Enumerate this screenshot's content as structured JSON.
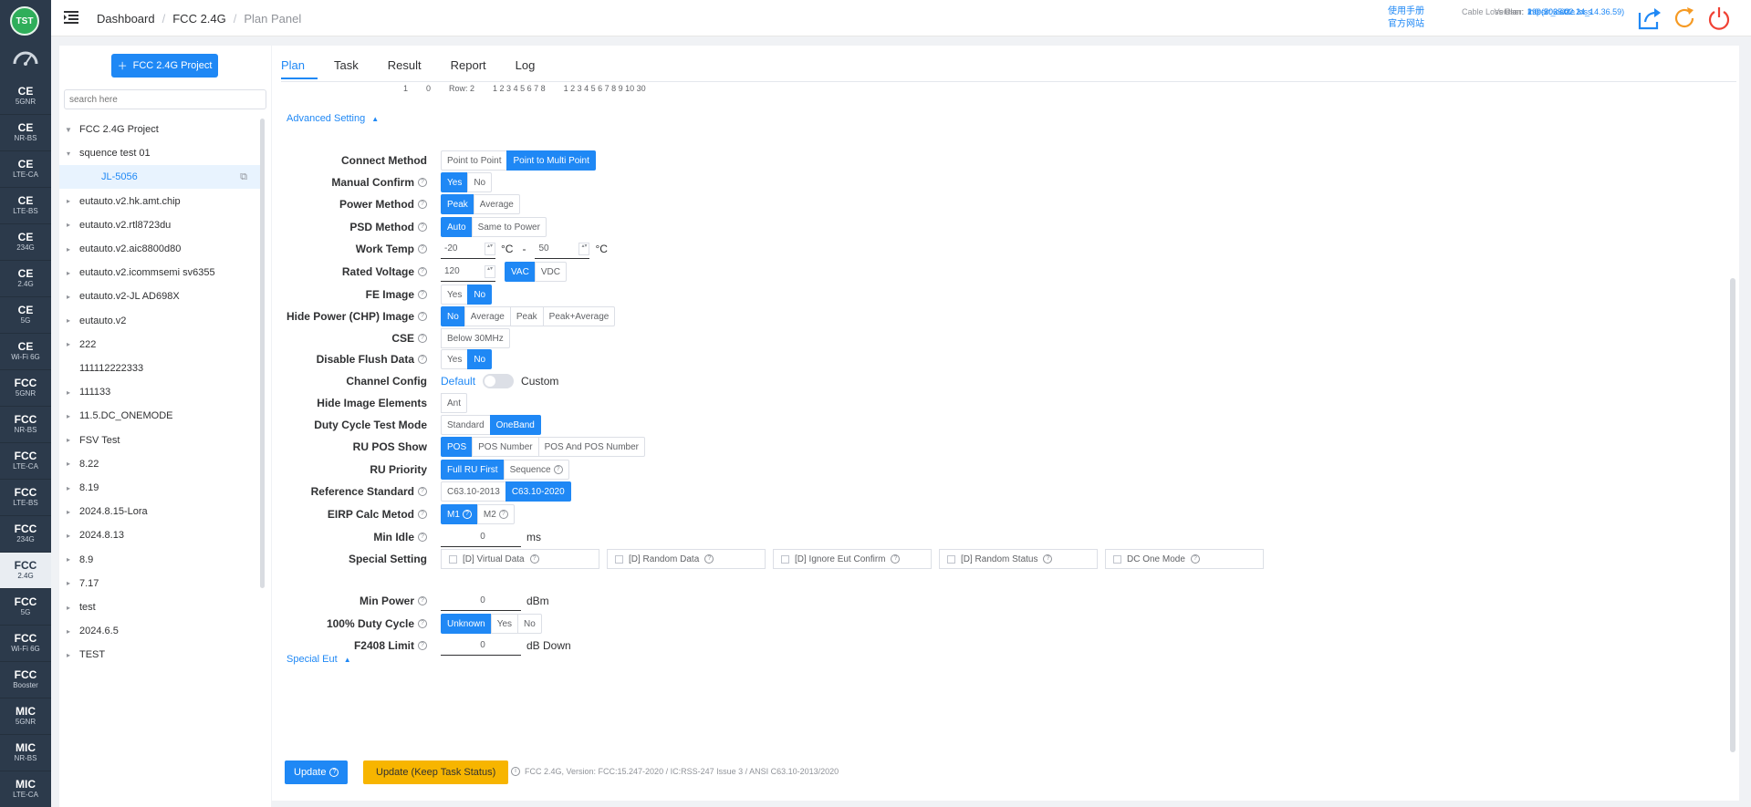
{
  "rail": {
    "logo": "TST",
    "items": [
      {
        "t1": "CE",
        "t2": "5GNR"
      },
      {
        "t1": "CE",
        "t2": "NR-BS"
      },
      {
        "t1": "CE",
        "t2": "LTE-CA"
      },
      {
        "t1": "CE",
        "t2": "LTE-BS"
      },
      {
        "t1": "CE",
        "t2": "234G"
      },
      {
        "t1": "CE",
        "t2": "2.4G"
      },
      {
        "t1": "CE",
        "t2": "5G"
      },
      {
        "t1": "CE",
        "t2": "Wi-Fi 6G"
      },
      {
        "t1": "FCC",
        "t2": "5GNR"
      },
      {
        "t1": "FCC",
        "t2": "NR-BS"
      },
      {
        "t1": "FCC",
        "t2": "LTE-CA"
      },
      {
        "t1": "FCC",
        "t2": "LTE-BS"
      },
      {
        "t1": "FCC",
        "t2": "234G"
      },
      {
        "t1": "FCC",
        "t2": "2.4G"
      },
      {
        "t1": "FCC",
        "t2": "5G"
      },
      {
        "t1": "FCC",
        "t2": "Wi-Fi 6G"
      },
      {
        "t1": "FCC",
        "t2": "Booster"
      },
      {
        "t1": "MIC",
        "t2": "5GNR"
      },
      {
        "t1": "MIC",
        "t2": "NR-BS"
      },
      {
        "t1": "MIC",
        "t2": "LTE-CA"
      }
    ]
  },
  "header": {
    "crumbs": [
      "Dashboard",
      "FCC 2.4G",
      "Plan Panel"
    ],
    "links": [
      "使用手册",
      "官方网站"
    ],
    "info": [
      {
        "k": "Version:",
        "v": "2.0 (2025.02.24_14.36.59)"
      },
      {
        "k": "User:",
        "v": "199-506-02"
      },
      {
        "k": "Cable Loss Plan:",
        "v": "Import_cable loss"
      }
    ]
  },
  "tree": {
    "add_label": "FCC 2.4G Project",
    "search_placeholder": "search here",
    "nodes": [
      {
        "label": "FCC 2.4G Project",
        "arrow": "▼",
        "indent": 0
      },
      {
        "label": "squence test 01",
        "arrow": "▾",
        "indent": 0
      },
      {
        "label": "JL-5056",
        "arrow": "",
        "indent": 1,
        "selected": true
      },
      {
        "label": "eutauto.v2.hk.amt.chip",
        "arrow": "▸",
        "indent": 0
      },
      {
        "label": "eutauto.v2.rtl8723du",
        "arrow": "▸",
        "indent": 0
      },
      {
        "label": "eutauto.v2.aic8800d80",
        "arrow": "▸",
        "indent": 0
      },
      {
        "label": "eutauto.v2.icommsemi sv6355",
        "arrow": "▸",
        "indent": 0
      },
      {
        "label": "eutauto.v2-JL AD698X",
        "arrow": "▸",
        "indent": 0
      },
      {
        "label": "eutauto.v2",
        "arrow": "▸",
        "indent": 0
      },
      {
        "label": "222",
        "arrow": "▸",
        "indent": 0
      },
      {
        "label": "111112222333",
        "arrow": "",
        "indent": 0
      },
      {
        "label": "111133",
        "arrow": "▸",
        "indent": 0
      },
      {
        "label": "11.5.DC_ONEMODE",
        "arrow": "▸",
        "indent": 0
      },
      {
        "label": "FSV Test",
        "arrow": "▸",
        "indent": 0
      },
      {
        "label": "8.22",
        "arrow": "▸",
        "indent": 0
      },
      {
        "label": "8.19",
        "arrow": "▸",
        "indent": 0
      },
      {
        "label": "2024.8.15-Lora",
        "arrow": "▸",
        "indent": 0
      },
      {
        "label": "2024.8.13",
        "arrow": "▸",
        "indent": 0
      },
      {
        "label": "8.9",
        "arrow": "▸",
        "indent": 0
      },
      {
        "label": "7.17",
        "arrow": "▸",
        "indent": 0
      },
      {
        "label": "test",
        "arrow": "▸",
        "indent": 0
      },
      {
        "label": "2024.6.5",
        "arrow": "▸",
        "indent": 0
      },
      {
        "label": "TEST",
        "arrow": "▸",
        "indent": 0
      }
    ]
  },
  "tabs": [
    "Plan",
    "Task",
    "Result",
    "Report",
    "Log"
  ],
  "cutoff": [
    "1",
    "0",
    "Row: 2",
    "1 2 3 4 5 6 7 8",
    "1 2 3 4 5 6 7 8 9 10 30"
  ],
  "advanced": {
    "title": "Advanced Setting",
    "connect_method": {
      "label": "Connect Method",
      "opts": [
        "Point to Point",
        "Point to Multi Point"
      ],
      "on": 1
    },
    "manual_confirm": {
      "label": "Manual Confirm",
      "opts": [
        "Yes",
        "No"
      ],
      "on": 0
    },
    "power_method": {
      "label": "Power Method",
      "opts": [
        "Peak",
        "Average"
      ],
      "on": 0
    },
    "psd_method": {
      "label": "PSD Method",
      "opts": [
        "Auto",
        "Same to Power"
      ],
      "on": 0
    },
    "work_temp": {
      "label": "Work Temp",
      "min": "-20",
      "max": "50",
      "unit": "°C",
      "dash": "-"
    },
    "rated_voltage": {
      "label": "Rated Voltage",
      "value": "120",
      "opts": [
        "VAC",
        "VDC"
      ],
      "on": 0
    },
    "fe_image": {
      "label": "FE Image",
      "opts": [
        "Yes",
        "No"
      ],
      "on": 1
    },
    "hide_power": {
      "label": "Hide Power (CHP) Image",
      "opts": [
        "No",
        "Average",
        "Peak",
        "Peak+Average"
      ],
      "on": 0
    },
    "cse": {
      "label": "CSE",
      "opts": [
        "Below 30MHz"
      ],
      "on": -1
    },
    "disable_flush": {
      "label": "Disable Flush Data",
      "opts": [
        "Yes",
        "No"
      ],
      "on": 1
    },
    "channel_config": {
      "label": "Channel Config",
      "left": "Default",
      "right": "Custom"
    },
    "hide_image_elements": {
      "label": "Hide Image Elements",
      "opts": [
        "Ant"
      ],
      "on": -1
    },
    "duty_cycle_mode": {
      "label": "Duty Cycle Test Mode",
      "opts": [
        "Standard",
        "OneBand"
      ],
      "on": 1
    },
    "ru_pos_show": {
      "label": "RU POS Show",
      "opts": [
        "POS",
        "POS Number",
        "POS And POS Number"
      ],
      "on": 0
    },
    "ru_priority": {
      "label": "RU Priority",
      "opts": [
        "Full RU First",
        "Sequence"
      ],
      "on": 0
    },
    "reference_standard": {
      "label": "Reference Standard",
      "opts": [
        "C63.10-2013",
        "C63.10-2020"
      ],
      "on": 1
    },
    "eirp_calc": {
      "label": "EIRP Calc Metod",
      "opts": [
        "M1",
        "M2"
      ],
      "on": 0
    },
    "min_idle": {
      "label": "Min Idle",
      "value": "0",
      "unit": "ms"
    },
    "special_setting": {
      "label": "Special Setting",
      "items": [
        "[D] Virtual Data",
        "[D] Random Data",
        "[D] Ignore Eut Confirm",
        "[D] Random Status",
        "DC One Mode"
      ]
    }
  },
  "special_eut": {
    "title": "Special Eut",
    "min_power": {
      "label": "Min Power",
      "value": "0",
      "unit": "dBm"
    },
    "duty_cycle": {
      "label": "100% Duty Cycle",
      "opts": [
        "Unknown",
        "Yes",
        "No"
      ],
      "on": 0
    },
    "f2408": {
      "label": "F2408 Limit",
      "value": "0",
      "unit": "dB Down"
    }
  },
  "footer": {
    "update": "Update",
    "update_keep": "Update (Keep Task Status)",
    "note": "FCC 2.4G, Version: FCC:15.247-2020 / IC:RSS-247 Issue 3 / ANSI C63.10-2013/2020"
  }
}
